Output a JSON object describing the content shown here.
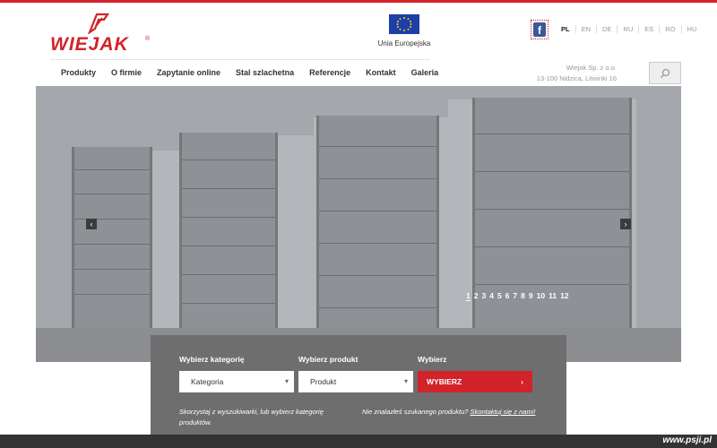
{
  "brand": {
    "name": "WIEJAK",
    "reg": "®",
    "accent": "#d2232a"
  },
  "eu": {
    "label": "Unia Europejska"
  },
  "languages": [
    {
      "code": "PL",
      "active": true
    },
    {
      "code": "EN"
    },
    {
      "code": "DE"
    },
    {
      "code": "RU"
    },
    {
      "code": "ES"
    },
    {
      "code": "RO"
    },
    {
      "code": "HU"
    }
  ],
  "nav": [
    "Produkty",
    "O firmie",
    "Zapytanie online",
    "Stal szlachetna",
    "Referencje",
    "Kontakt",
    "Galeria"
  ],
  "company": {
    "line1": "Wiejak Sp. z o.o.",
    "line2": "13-100 Nidzica, Litwinki 16"
  },
  "slider": {
    "pages": [
      "1",
      "2",
      "3",
      "4",
      "5",
      "6",
      "7",
      "8",
      "9",
      "10",
      "11",
      "12"
    ],
    "active_page": "1"
  },
  "finder": {
    "category_label": "Wybierz kategorię",
    "category_value": "Kategoria",
    "product_label": "Wybierz produkt",
    "product_value": "Produkt",
    "choose_label": "Wybierz",
    "choose_button": "WYBIERZ",
    "help_left": "Skorzystaj z wyszukiwarki, lub wybierz kategorię produktów.",
    "help_right_text": "Nie znalazłeś szukanego produktu?",
    "help_right_link": "Skontaktuj się z nami!"
  },
  "watermark": "www.psji.pl"
}
